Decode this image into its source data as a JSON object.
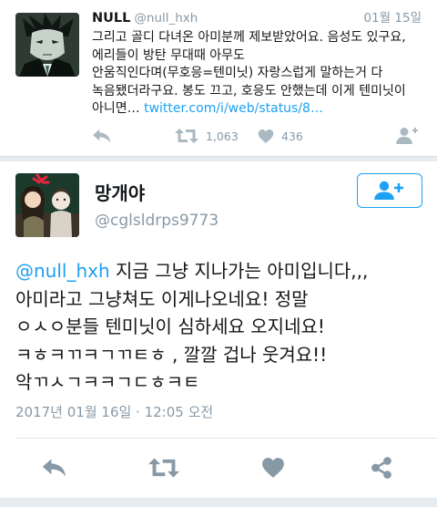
{
  "parent_tweet": {
    "name": "NULL",
    "handle": "@null_hxh",
    "date": "01월 15일",
    "text": "그리고 골디 다녀온 아미분께 제보받았어요. 음성도 있구요,\n에리들이 방탄 무대때 아무도\n안움직인다며(무호응=텐미닛) 자랑스럽게 말하는거 다\n녹음됐더라구요. 봉도 끄고, 호응도 안했는데 이게 텐미닛이\n아니면… ",
    "link": "twitter.com/i/web/status/8…",
    "retweet_count": "1,063",
    "like_count": "436",
    "icons": {
      "reply": "reply-icon",
      "retweet": "retweet-icon",
      "like": "heart-icon",
      "follow": "follow-icon"
    }
  },
  "main_tweet": {
    "name": "망개야",
    "handle": "@cglsldrps9773",
    "lines": [
      {
        "mention": "@null_hxh",
        "text": " 지금 그냥 지나가는 아미입니다,,,"
      },
      {
        "mention": "",
        "text": "아미라고 그냥쳐도 이게나오네요!  정말"
      },
      {
        "mention": "",
        "text": "ㅇㅅㅇ분들 텐미닛이 심하세요 오지네요!"
      },
      {
        "mention": "",
        "text": "ㅋㅎㅋㄲㅋㄱㄲㅌㅎ ,  깔깔 겁나 웃겨요!!"
      },
      {
        "mention": "",
        "text": "악ㄲㅅㄱㅋㅋㄱㄷㅎㅋㅌ"
      }
    ],
    "timestamp": "2017년 01월 16일 · 12:05 오전",
    "icons": {
      "reply": "reply-icon",
      "retweet": "retweet-icon",
      "like": "heart-icon",
      "share": "share-icon",
      "follow": "follow-icon"
    }
  },
  "colors": {
    "accent": "#1da1f2",
    "muted": "#8899a6",
    "text": "#14171a",
    "divider": "#e6ecf0"
  }
}
